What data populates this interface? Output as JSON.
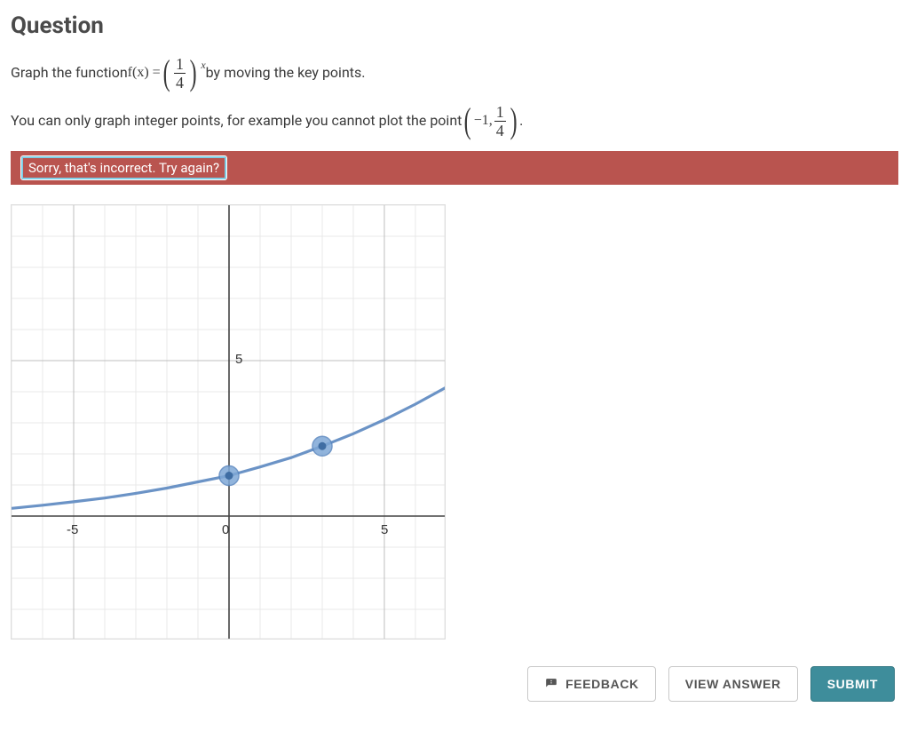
{
  "heading": "Question",
  "prompt": {
    "part1": "Graph the function ",
    "func_lhs": "f(x) = ",
    "frac_top": "1",
    "frac_bot": "4",
    "exponent": "x",
    "part2": " by moving the key points.",
    "line2_a": "You can only graph integer points, for example you cannot plot the point ",
    "pt_x": "−1, ",
    "pt_frac_top": "1",
    "pt_frac_bot": "4",
    "period": "."
  },
  "feedback": "Sorry, that's incorrect. Try again?",
  "axes": {
    "y_tick": "5",
    "x_neg": "-5",
    "x_zero": "0",
    "x_pos": "5"
  },
  "chart_data": {
    "type": "line",
    "title": "",
    "xlabel": "",
    "ylabel": "",
    "xlim": [
      -7,
      7
    ],
    "ylim": [
      -4,
      10
    ],
    "x": [
      -7,
      -6,
      -5,
      -4,
      -3,
      -2,
      -1,
      0,
      1,
      2,
      3,
      4,
      5,
      6,
      7
    ],
    "y": [
      0.25,
      0.35,
      0.46,
      0.58,
      0.73,
      0.9,
      1.1,
      1.3,
      1.58,
      1.88,
      2.25,
      2.65,
      3.1,
      3.6,
      4.15
    ],
    "key_points": [
      {
        "x": 0,
        "y": 1.3
      },
      {
        "x": 3,
        "y": 2.25
      }
    ]
  },
  "buttons": {
    "feedback": "FEEDBACK",
    "view_answer": "VIEW ANSWER",
    "submit": "SUBMIT"
  }
}
